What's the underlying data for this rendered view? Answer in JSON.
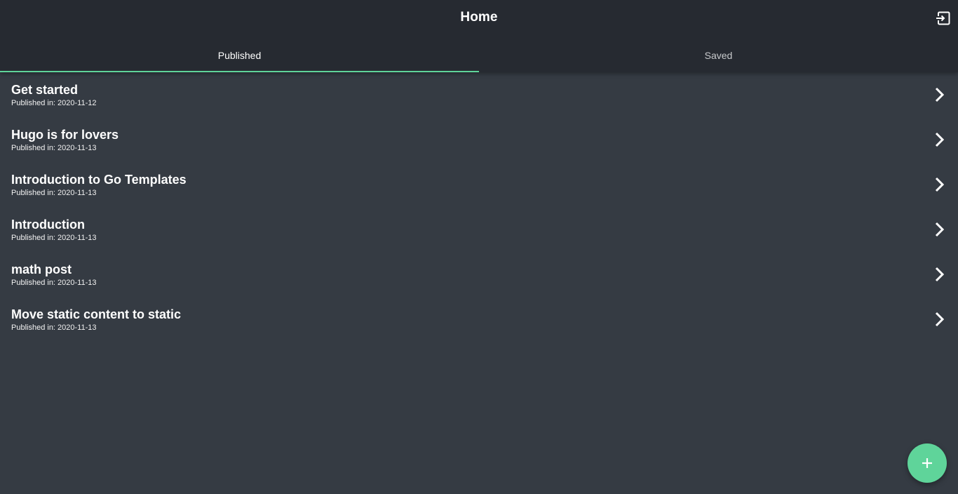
{
  "header": {
    "title": "Home",
    "logout_icon": "logout-icon"
  },
  "tabs": [
    {
      "label": "Published",
      "active": true
    },
    {
      "label": "Saved",
      "active": false
    }
  ],
  "posts": [
    {
      "title": "Get started",
      "date": "Published in: 2020-11-12"
    },
    {
      "title": "Hugo is for lovers",
      "date": "Published in: 2020-11-13"
    },
    {
      "title": "Introduction to Go Templates",
      "date": "Published in: 2020-11-13"
    },
    {
      "title": "Introduction",
      "date": "Published in: 2020-11-13"
    },
    {
      "title": "math post",
      "date": "Published in: 2020-11-13"
    },
    {
      "title": "Move static content to static",
      "date": "Published in: 2020-11-13"
    }
  ],
  "fab": {
    "icon": "plus-icon"
  },
  "colors": {
    "accent": "#5fd49a",
    "header_bg": "#262a31",
    "content_bg": "#353b43"
  }
}
